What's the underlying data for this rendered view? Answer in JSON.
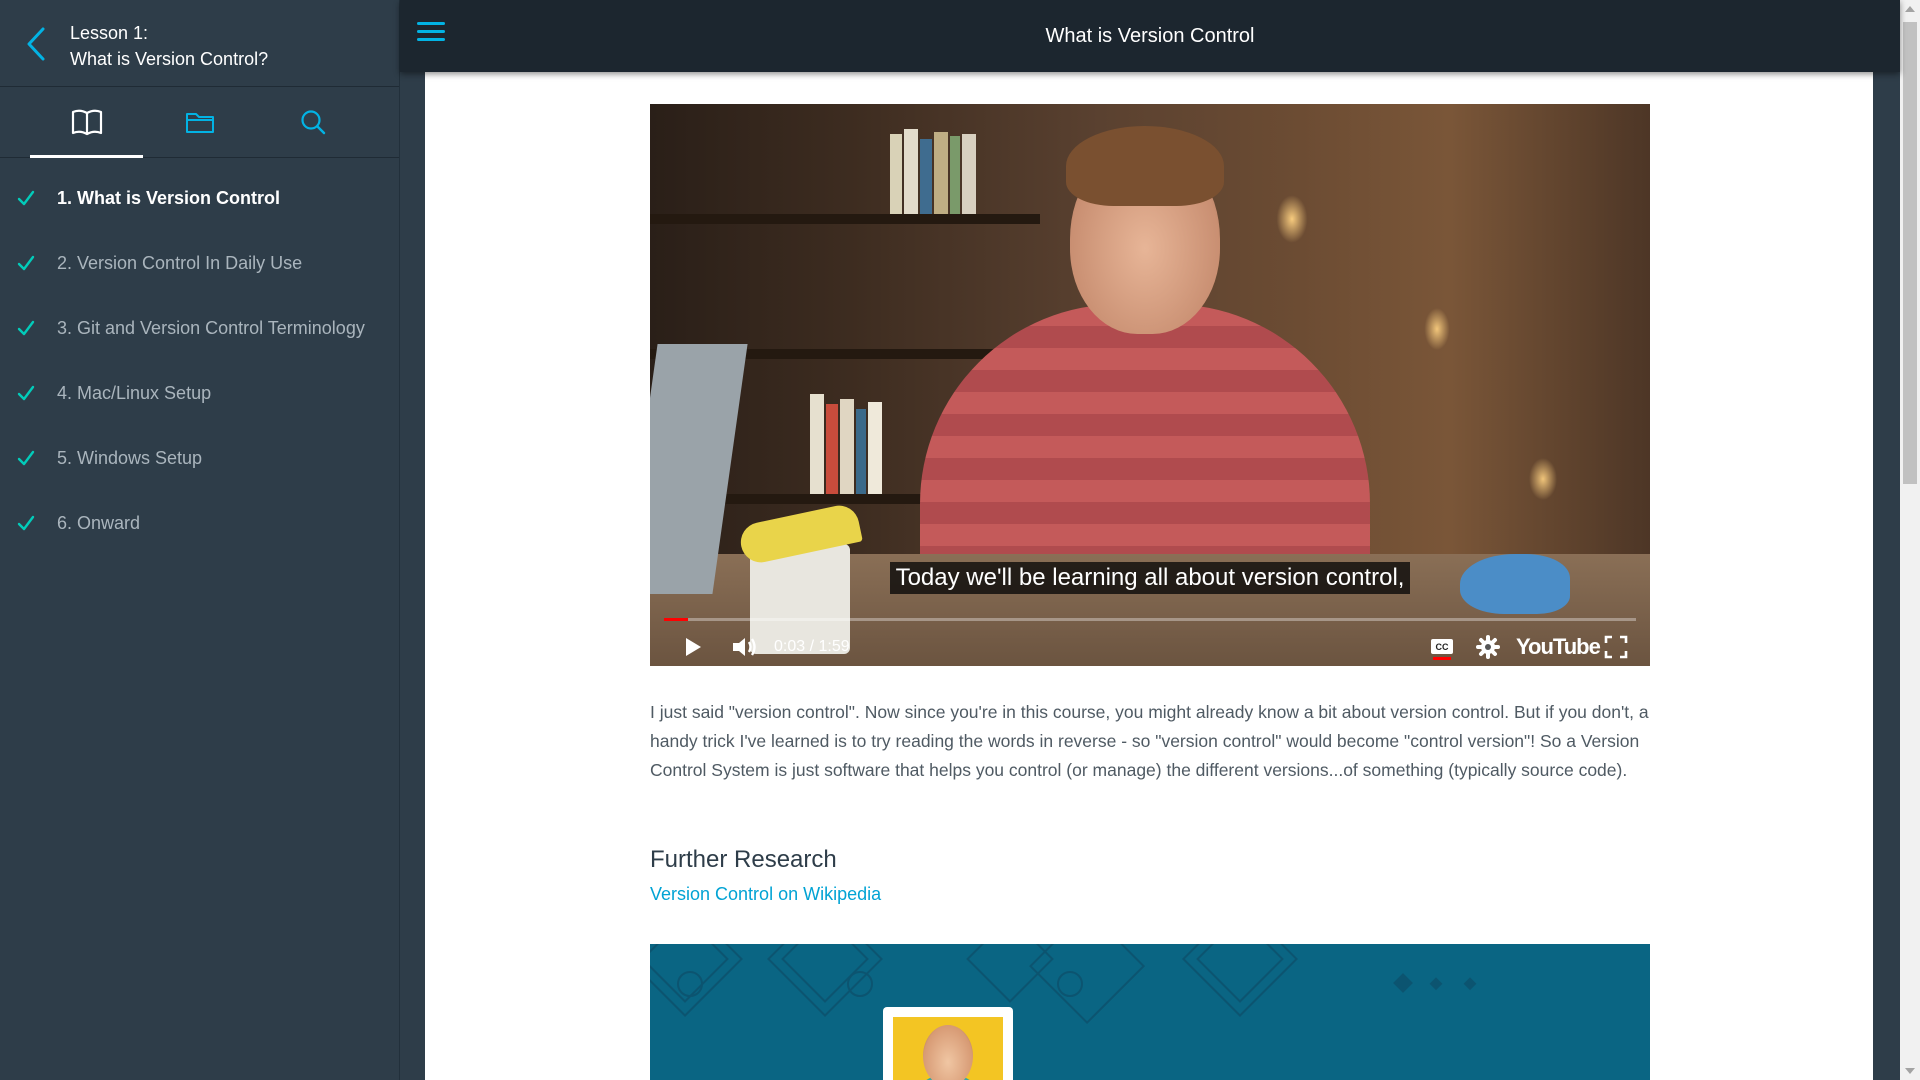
{
  "sidebar": {
    "back_icon": "chevron-left-icon",
    "lesson_label": "Lesson 1:",
    "lesson_name": "What is Version Control?",
    "tabs": [
      {
        "name": "concepts",
        "icon": "book-icon",
        "active": true
      },
      {
        "name": "resources",
        "icon": "folder-icon",
        "active": false
      },
      {
        "name": "search",
        "icon": "search-icon",
        "active": false
      }
    ],
    "concepts": [
      {
        "label": "1. What is Version Control",
        "completed": true,
        "active": true
      },
      {
        "label": "2. Version Control In Daily Use",
        "completed": true,
        "active": false
      },
      {
        "label": "3. Git and Version Control Terminology",
        "completed": true,
        "active": false
      },
      {
        "label": "4. Mac/Linux Setup",
        "completed": true,
        "active": false
      },
      {
        "label": "5. Windows Setup",
        "completed": true,
        "active": false
      },
      {
        "label": "6. Onward",
        "completed": true,
        "active": false
      }
    ]
  },
  "topbar": {
    "menu_icon": "hamburger-menu-icon",
    "title": "What is Version Control"
  },
  "video": {
    "subtitle": "Today we'll be learning all about version control,",
    "time": "0:03 / 1:59",
    "progress_fraction": 0.025,
    "youtube_label": "YouTube",
    "controls": [
      "play-icon",
      "volume-icon",
      "closed-captions-icon",
      "settings-gear-icon",
      "fullscreen-icon"
    ]
  },
  "content": {
    "paragraph": "I just said \"version control\". Now since you're in this course, you might already know a bit about version control. But if you don't, a handy trick I've learned is to try reading the words in reverse - so \"version control\" would become \"control version\"! So a Version Control System is just software that helps you control (or manage) the different versions...of something (typically source code).",
    "heading": "Further Research",
    "link_text": "Version Control on Wikipedia"
  },
  "colors": {
    "sidebar_bg": "#2e3d49",
    "topbar_bg": "#1c262f",
    "accent": "#02b3e4",
    "link": "#02a3d4",
    "check": "#02ccba",
    "banner_bg": "#0a6583"
  }
}
